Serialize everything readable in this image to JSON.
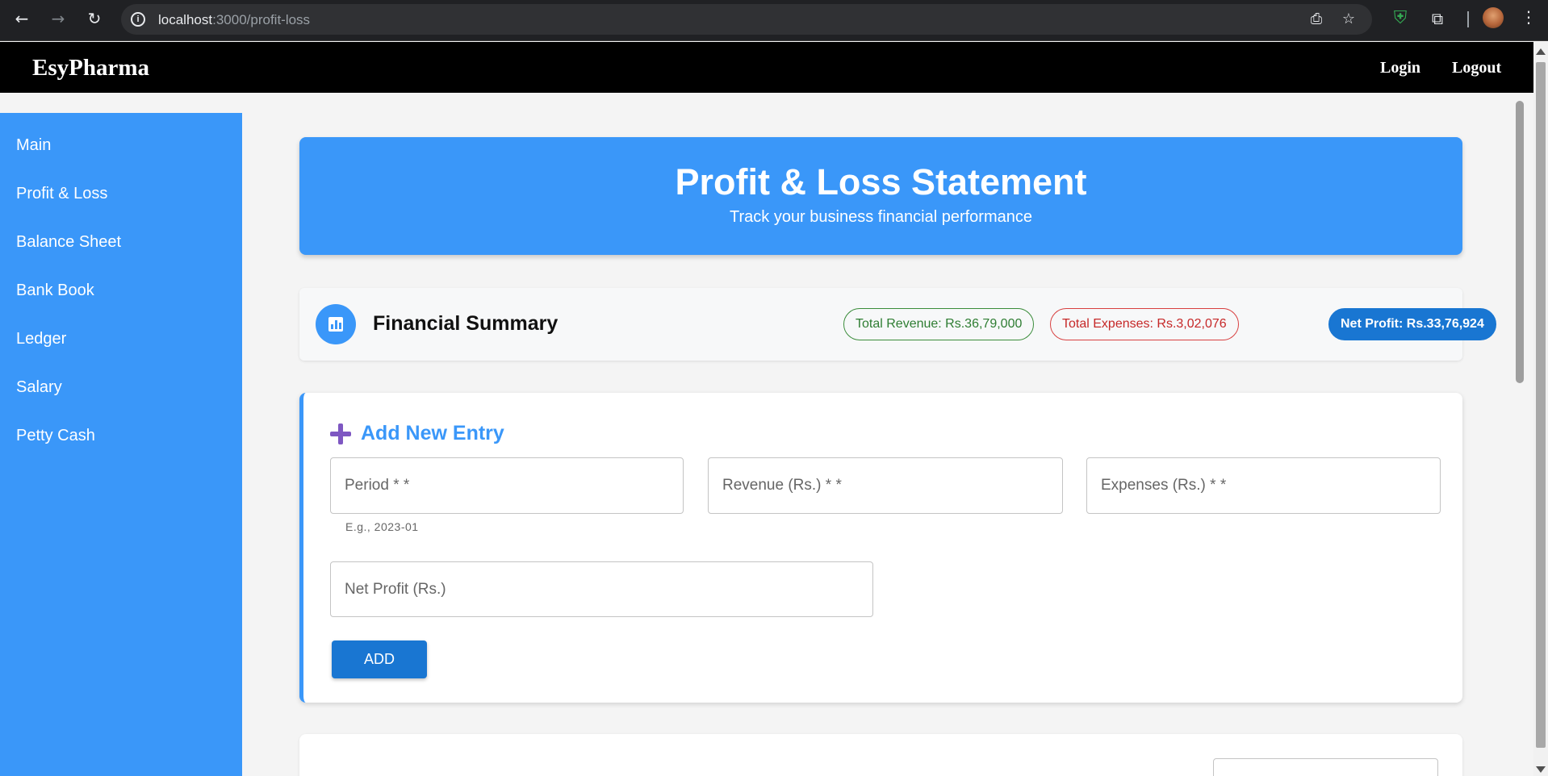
{
  "browser": {
    "url_host": "localhost",
    "url_rest": ":3000/profit-loss"
  },
  "header": {
    "brand": "EsyPharma",
    "login": "Login",
    "logout": "Logout"
  },
  "sidebar": {
    "items": [
      {
        "label": "Main"
      },
      {
        "label": "Profit & Loss"
      },
      {
        "label": "Balance Sheet"
      },
      {
        "label": "Bank Book"
      },
      {
        "label": "Ledger"
      },
      {
        "label": "Salary"
      },
      {
        "label": "Petty Cash"
      }
    ]
  },
  "hero": {
    "title": "Profit & Loss Statement",
    "subtitle": "Track your business financial performance"
  },
  "summary": {
    "title": "Financial Summary",
    "total_revenue": "Total Revenue: Rs.36,79,000",
    "total_expenses": "Total Expenses: Rs.3,02,076",
    "net_profit": "Net Profit: Rs.33,76,924"
  },
  "entry": {
    "title": "Add New Entry",
    "period_label": "Period * *",
    "period_helper": "E.g., 2023-01",
    "revenue_label": "Revenue (Rs.) * *",
    "expenses_label": "Expenses (Rs.) * *",
    "net_profit_label": "Net Profit (Rs.)",
    "add_button": "ADD"
  },
  "colors": {
    "primary": "#3a97f9",
    "button": "#1976d2",
    "revenue": "#2e7d32",
    "expenses": "#c62828",
    "plus_icon": "#7e57c2"
  }
}
